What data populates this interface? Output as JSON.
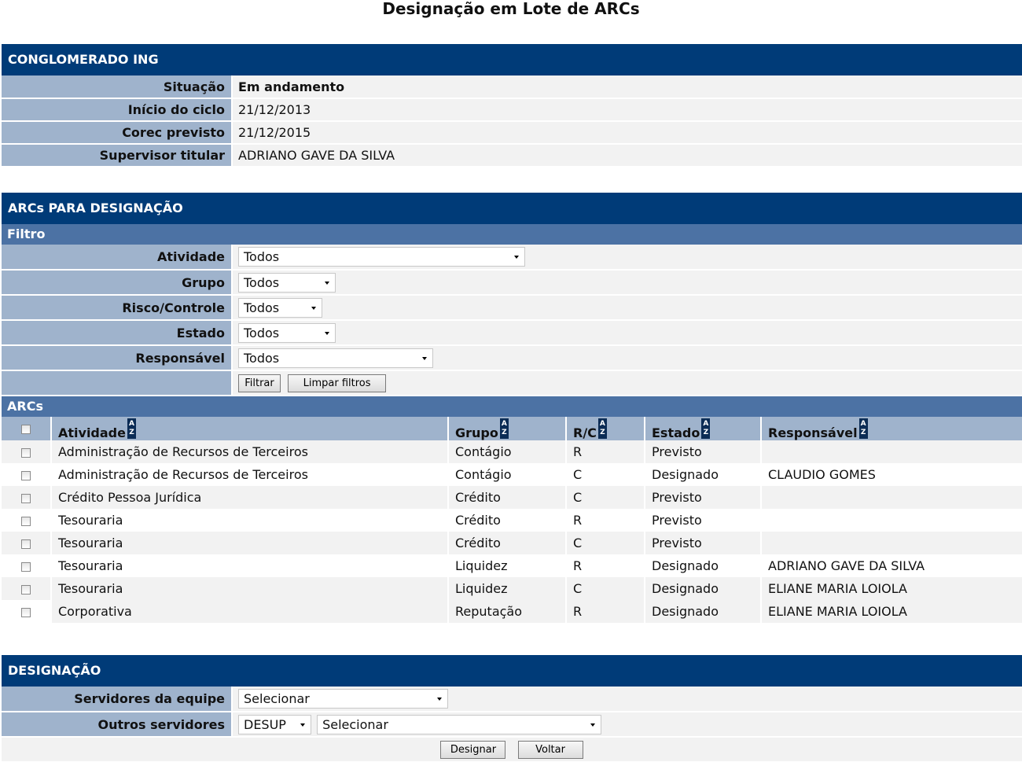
{
  "page": {
    "title": "Designação em Lote de ARCs"
  },
  "conglomerado": {
    "header": "CONGLOMERADO ING",
    "rows": [
      {
        "label": "Situação",
        "value": "Em andamento"
      },
      {
        "label": "Início do ciclo",
        "value": "21/12/2013"
      },
      {
        "label": "Corec previsto",
        "value": "21/12/2015"
      },
      {
        "label": "Supervisor titular",
        "value": "ADRIANO GAVE DA SILVA"
      }
    ]
  },
  "arcs_section": {
    "header": "ARCs PARA DESIGNAÇÃO",
    "filter": {
      "header": "Filtro",
      "atividade": {
        "label": "Atividade",
        "value": "Todos"
      },
      "grupo": {
        "label": "Grupo",
        "value": "Todos"
      },
      "risco_controle": {
        "label": "Risco/Controle",
        "value": "Todos"
      },
      "estado": {
        "label": "Estado",
        "value": "Todos"
      },
      "responsavel": {
        "label": "Responsável",
        "value": "Todos"
      },
      "filtrar_label": "Filtrar",
      "limpar_label": "Limpar filtros"
    },
    "grid": {
      "header": "ARCs",
      "sort_icon_text": [
        "A",
        "Z"
      ],
      "columns": {
        "atividade": "Atividade",
        "grupo": "Grupo",
        "rc": "R/C",
        "estado": "Estado",
        "responsavel": "Responsável"
      },
      "rows": [
        {
          "atividade": "Administração de Recursos de Terceiros",
          "grupo": "Contágio",
          "rc": "R",
          "estado": "Previsto",
          "responsavel": ""
        },
        {
          "atividade": "Administração de Recursos de Terceiros",
          "grupo": "Contágio",
          "rc": "C",
          "estado": "Designado",
          "responsavel": "CLAUDIO GOMES"
        },
        {
          "atividade": "Crédito Pessoa Jurídica",
          "grupo": "Crédito",
          "rc": "C",
          "estado": "Previsto",
          "responsavel": ""
        },
        {
          "atividade": "Tesouraria",
          "grupo": "Crédito",
          "rc": "R",
          "estado": "Previsto",
          "responsavel": ""
        },
        {
          "atividade": "Tesouraria",
          "grupo": "Crédito",
          "rc": "C",
          "estado": "Previsto",
          "responsavel": ""
        },
        {
          "atividade": "Tesouraria",
          "grupo": "Liquidez",
          "rc": "R",
          "estado": "Designado",
          "responsavel": "ADRIANO GAVE DA SILVA"
        },
        {
          "atividade": "Tesouraria",
          "grupo": "Liquidez",
          "rc": "C",
          "estado": "Designado",
          "responsavel": "ELIANE MARIA LOIOLA"
        },
        {
          "atividade": "Corporativa",
          "grupo": "Reputação",
          "rc": "R",
          "estado": "Designado",
          "responsavel": "ELIANE MARIA LOIOLA"
        }
      ]
    }
  },
  "designacao": {
    "header": "DESIGNAÇÃO",
    "servidores_equipe": {
      "label": "Servidores da equipe",
      "value": "Selecionar"
    },
    "outros_servidores": {
      "label": "Outros servidores",
      "unit_value": "DESUP",
      "value": "Selecionar"
    },
    "designar_label": "Designar",
    "voltar_label": "Voltar"
  }
}
